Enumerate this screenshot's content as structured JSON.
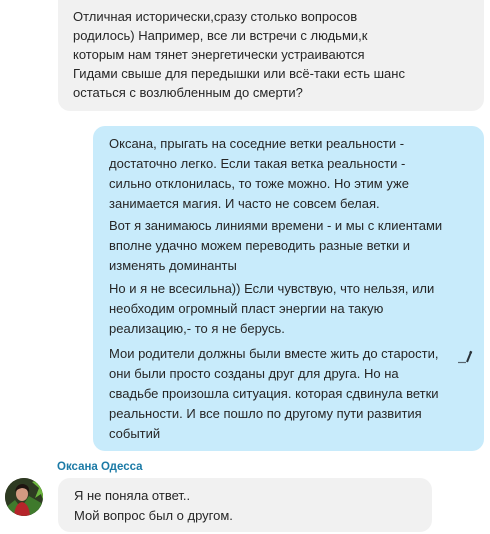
{
  "messages": {
    "incoming_top": {
      "text": "Отличная исторически,сразу столько вопросов\nродилось) Например, все ли встречи с людьми,к\nкоторым нам тянет энергетически устраиваются\nГидами свыше для передышки или всё-таки есть шанс\nостаться с возлюбленным до смерти?"
    },
    "outgoing": {
      "paragraphs": [
        "Оксана, прыгать на соседние ветки реальности -\nдостаточно легко. Если такая ветка реальности -\nсильно отклонилась, то тоже можно. Но этим уже\nзанимается магия. И часто не совсем белая.",
        "Вот я занимаюсь линиями времени - и мы с клиентами\nвполне удачно можем переводить разные ветки и\nизменять доминанты",
        "Но и я не всесильна)) Если чувствую, что нельзя, или\nнеобходим огромный пласт энергии на такую\nреализацию,-  то я не берусь.",
        "Мои родители должны были вместе жить до старости,\nони были просто созданы друг для друга. Но на\nсвадьбе произошла ситуация. которая сдвинула ветки\nреальности. И все пошло по другому пути развития\nсобытий"
      ]
    },
    "incoming_bottom": {
      "sender": "Оксана Одесса",
      "text": "Я не поняла ответ..\nМой вопрос был о другом."
    }
  },
  "colors": {
    "incoming_bubble": "#f1f1f1",
    "outgoing_bubble": "#c8ebfb",
    "sender_name": "#1b7aa6"
  },
  "icons": {
    "edit": "pencil-icon",
    "avatar": "avatar-photo"
  }
}
